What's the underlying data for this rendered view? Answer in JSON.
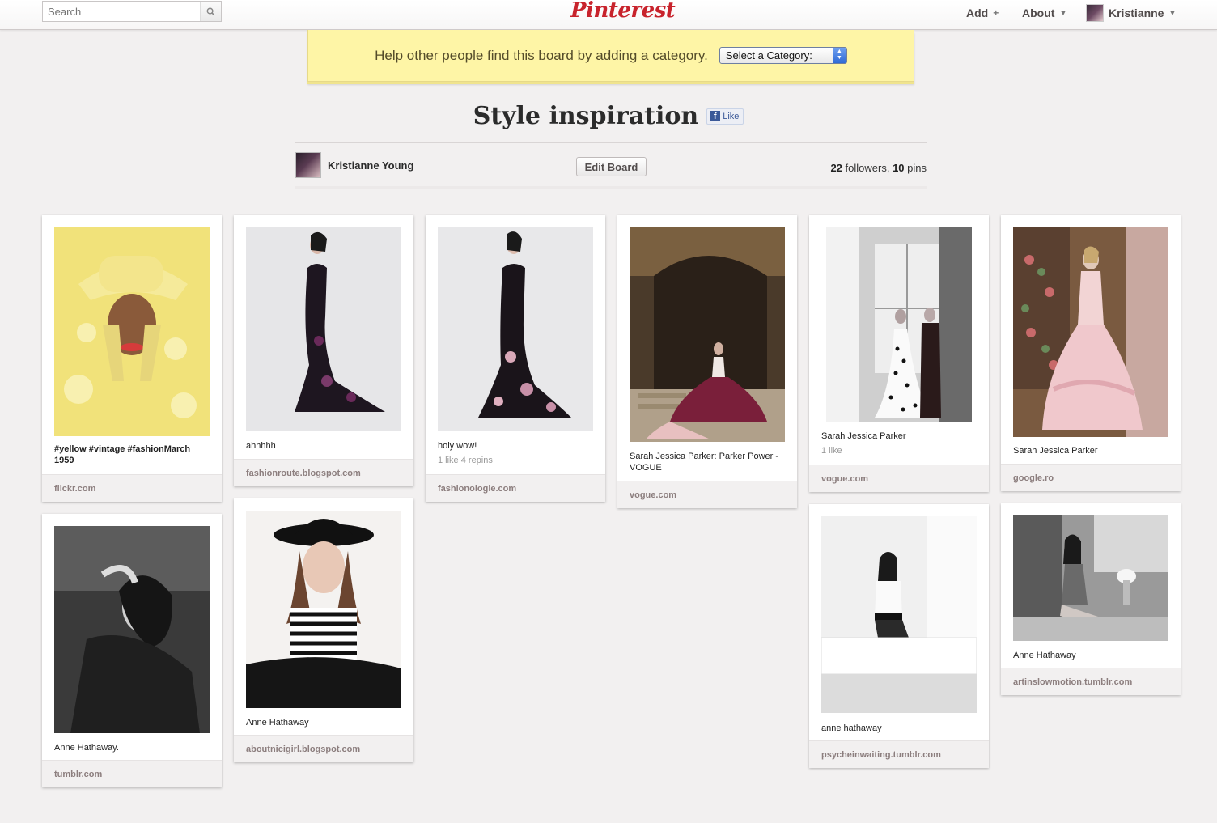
{
  "header": {
    "search_placeholder": "Search",
    "logo": "Pinterest",
    "nav": {
      "add": "Add",
      "about": "About",
      "user": "Kristianne"
    }
  },
  "banner": {
    "text": "Help other people find this board by adding a category.",
    "select_value": "Select a Category:"
  },
  "board": {
    "title": "Style inspiration",
    "like_label": "Like",
    "owner": "Kristianne Young",
    "edit_label": "Edit Board",
    "followers_count": "22",
    "followers_label": " followers, ",
    "pins_count": "10",
    "pins_label": " pins"
  },
  "pins": [
    {
      "desc": "#yellow #vintage #fashionMarch 1959",
      "stats": "",
      "source": "flickr.com"
    },
    {
      "desc": "ahhhhh",
      "stats": "",
      "source": "fashionroute.blogspot.com"
    },
    {
      "desc": "holy wow!",
      "stats": "1 like  4 repins",
      "source": "fashionologie.com"
    },
    {
      "desc": "Sarah Jessica Parker: Parker Power - VOGUE",
      "stats": "",
      "source": "vogue.com"
    },
    {
      "desc": "Sarah Jessica Parker",
      "stats": "1 like",
      "source": "vogue.com"
    },
    {
      "desc": "Sarah Jessica Parker",
      "stats": "",
      "source": "google.ro"
    },
    {
      "desc": "Anne Hathaway.",
      "stats": "",
      "source": "tumblr.com"
    },
    {
      "desc": "Anne Hathaway",
      "stats": "",
      "source": "aboutnicigirl.blogspot.com"
    },
    {
      "desc": "anne hathaway",
      "stats": "",
      "source": "psycheinwaiting.tumblr.com"
    },
    {
      "desc": "Anne Hathaway",
      "stats": "",
      "source": "artinslowmotion.tumblr.com"
    }
  ],
  "colors": {
    "brand": "#c8232c",
    "banner": "#fef5a6",
    "background": "#f2f0f0"
  }
}
